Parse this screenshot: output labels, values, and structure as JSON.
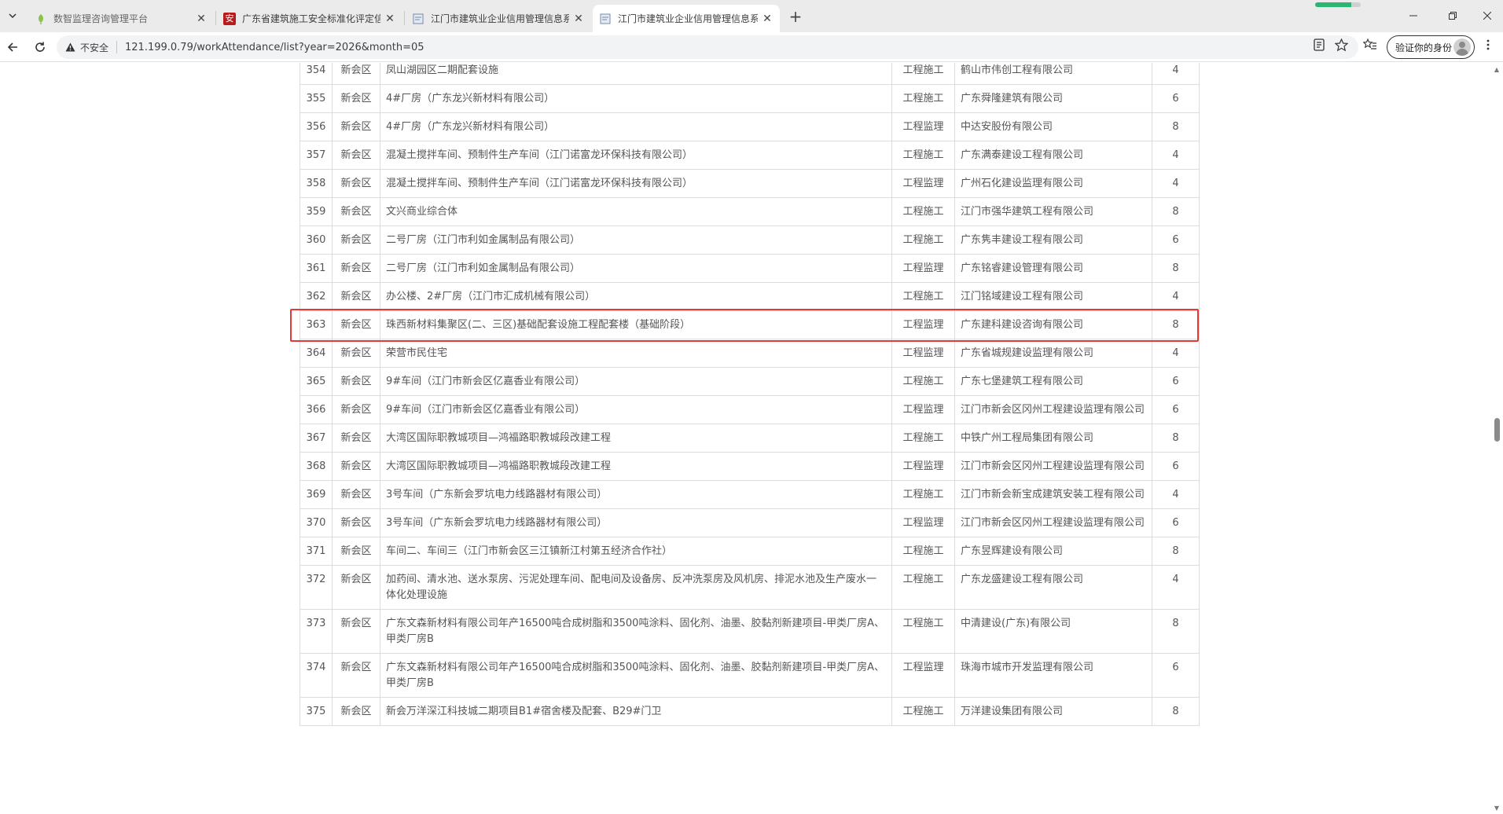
{
  "browser": {
    "tabs": [
      {
        "title": "数智监理咨询管理平台",
        "favicon": "leaf-icon",
        "active": false
      },
      {
        "title": "广东省建筑施工安全标准化评定信",
        "favicon": "red-an-badge-icon",
        "badge": "安",
        "active": false
      },
      {
        "title": "江门市建筑业企业信用管理信息系",
        "favicon": "page-icon",
        "active": false
      },
      {
        "title": "江门市建筑业企业信用管理信息系",
        "favicon": "page-icon",
        "active": true
      }
    ],
    "security_label": "不安全",
    "url": "121.199.0.79/workAttendance/list?year=2026&month=05",
    "profile_label": "验证你的身份",
    "load_progress": 0.8,
    "accent_color": "#2bb673"
  },
  "table": {
    "rows": [
      {
        "idx": "354",
        "district": "新会区",
        "project": "凤山湖园区二期配套设施",
        "type": "工程施工",
        "company": "鹤山市伟创工程有限公司",
        "count": "4"
      },
      {
        "idx": "355",
        "district": "新会区",
        "project": "4#厂房（广东龙兴新材料有限公司）",
        "type": "工程施工",
        "company": "广东舜隆建筑有限公司",
        "count": "6"
      },
      {
        "idx": "356",
        "district": "新会区",
        "project": "4#厂房（广东龙兴新材料有限公司）",
        "type": "工程监理",
        "company": "中达安股份有限公司",
        "count": "8"
      },
      {
        "idx": "357",
        "district": "新会区",
        "project": "混凝土搅拌车间、预制件生产车间（江门诺富龙环保科技有限公司）",
        "type": "工程施工",
        "company": "广东满泰建设工程有限公司",
        "count": "4"
      },
      {
        "idx": "358",
        "district": "新会区",
        "project": "混凝土搅拌车间、预制件生产车间（江门诺富龙环保科技有限公司）",
        "type": "工程监理",
        "company": "广州石化建设监理有限公司",
        "count": "4"
      },
      {
        "idx": "359",
        "district": "新会区",
        "project": "文兴商业综合体",
        "type": "工程施工",
        "company": "江门市强华建筑工程有限公司",
        "count": "8"
      },
      {
        "idx": "360",
        "district": "新会区",
        "project": "二号厂房（江门市利如金属制品有限公司）",
        "type": "工程施工",
        "company": "广东隽丰建设工程有限公司",
        "count": "6"
      },
      {
        "idx": "361",
        "district": "新会区",
        "project": "二号厂房（江门市利如金属制品有限公司）",
        "type": "工程监理",
        "company": "广东铭睿建设管理有限公司",
        "count": "8"
      },
      {
        "idx": "362",
        "district": "新会区",
        "project": "办公楼、2#厂房（江门市汇成机械有限公司）",
        "type": "工程施工",
        "company": "江门铭域建设工程有限公司",
        "count": "4"
      },
      {
        "idx": "363",
        "district": "新会区",
        "project": "珠西新材料集聚区(二、三区)基础配套设施工程配套楼（基础阶段）",
        "type": "工程监理",
        "company": "广东建科建设咨询有限公司",
        "count": "8",
        "highlighted": true
      },
      {
        "idx": "364",
        "district": "新会区",
        "project": "荣营市民住宅",
        "type": "工程监理",
        "company": "广东省城规建设监理有限公司",
        "count": "4"
      },
      {
        "idx": "365",
        "district": "新会区",
        "project": "9#车间（江门市新会区亿嘉香业有限公司）",
        "type": "工程施工",
        "company": "广东七堡建筑工程有限公司",
        "count": "6"
      },
      {
        "idx": "366",
        "district": "新会区",
        "project": "9#车间（江门市新会区亿嘉香业有限公司）",
        "type": "工程监理",
        "company": "江门市新会区冈州工程建设监理有限公司",
        "count": "6"
      },
      {
        "idx": "367",
        "district": "新会区",
        "project": "大湾区国际职教城项目—鸿福路职教城段改建工程",
        "type": "工程施工",
        "company": "中铁广州工程局集团有限公司",
        "count": "8"
      },
      {
        "idx": "368",
        "district": "新会区",
        "project": "大湾区国际职教城项目—鸿福路职教城段改建工程",
        "type": "工程监理",
        "company": "江门市新会区冈州工程建设监理有限公司",
        "count": "6"
      },
      {
        "idx": "369",
        "district": "新会区",
        "project": "3号车间（广东新会罗坑电力线路器材有限公司）",
        "type": "工程施工",
        "company": "江门市新会新宝成建筑安装工程有限公司",
        "count": "4"
      },
      {
        "idx": "370",
        "district": "新会区",
        "project": "3号车间（广东新会罗坑电力线路器材有限公司）",
        "type": "工程监理",
        "company": "江门市新会区冈州工程建设监理有限公司",
        "count": "6"
      },
      {
        "idx": "371",
        "district": "新会区",
        "project": "车间二、车间三（江门市新会区三江镇新江村第五经济合作社）",
        "type": "工程施工",
        "company": "广东昱辉建设有限公司",
        "count": "8"
      },
      {
        "idx": "372",
        "district": "新会区",
        "project": "加药间、清水池、送水泵房、污泥处理车间、配电间及设备房、反冲洗泵房及风机房、排泥水池及生产废水一体化处理设施",
        "type": "工程施工",
        "company": "广东龙盛建设工程有限公司",
        "count": "4"
      },
      {
        "idx": "373",
        "district": "新会区",
        "project": "广东文森新材料有限公司年产16500吨合成树脂和3500吨涂料、固化剂、油墨、胶黏剂新建项目-甲类厂房A、甲类厂房B",
        "type": "工程施工",
        "company": "中清建设(广东)有限公司",
        "count": "8"
      },
      {
        "idx": "374",
        "district": "新会区",
        "project": "广东文森新材料有限公司年产16500吨合成树脂和3500吨涂料、固化剂、油墨、胶黏剂新建项目-甲类厂房A、甲类厂房B",
        "type": "工程监理",
        "company": "珠海市城市开发监理有限公司",
        "count": "6"
      },
      {
        "idx": "375",
        "district": "新会区",
        "project": "新会万洋深江科技城二期项目B1#宿舍楼及配套、B29#门卫",
        "type": "工程施工",
        "company": "万洋建设集团有限公司",
        "count": "8"
      }
    ],
    "highlight_color": "#e53935"
  }
}
